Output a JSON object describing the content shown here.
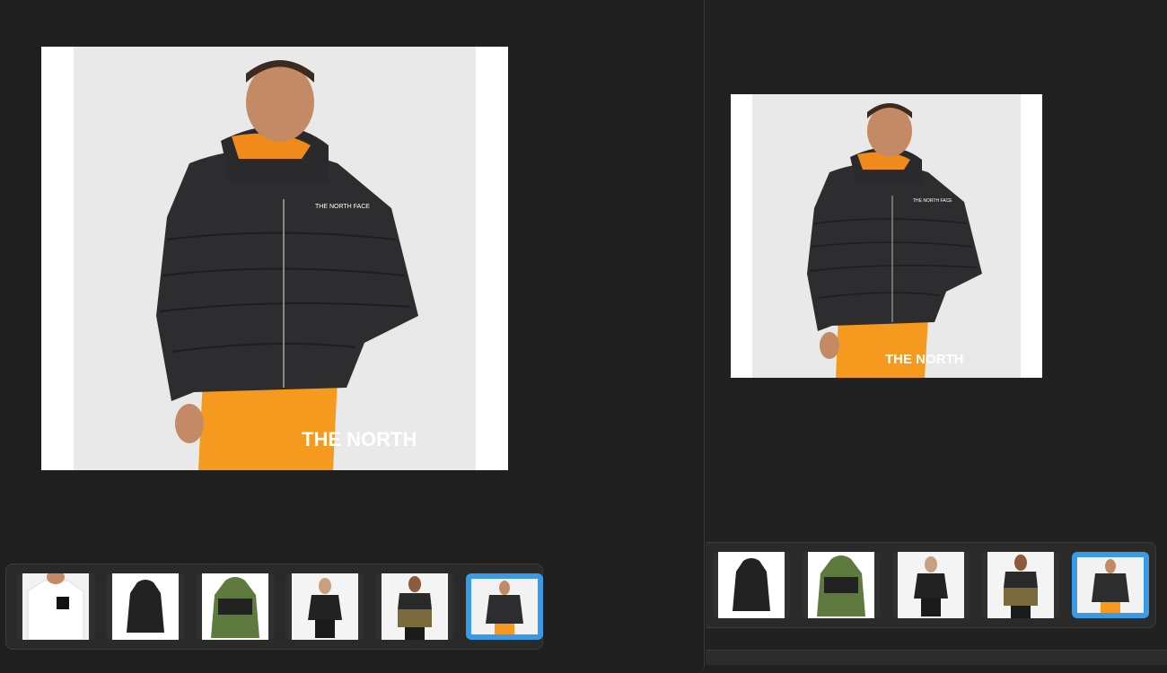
{
  "viewer": {
    "left_panel": {
      "main_image": {
        "description_icon": "product-photo-black-puffer-jacket",
        "logo_text": "THE NORTH FACE",
        "pants_text": "THE NORTH"
      },
      "thumbnails": [
        {
          "icon": "white-tshirt-thumb",
          "selected": false
        },
        {
          "icon": "black-parka-thumb",
          "selected": false
        },
        {
          "icon": "green-black-jacket-thumb",
          "selected": false
        },
        {
          "icon": "woman-black-jacket-thumb",
          "selected": false
        },
        {
          "icon": "olive-black-jacket-thumb",
          "selected": false
        },
        {
          "icon": "black-puffer-orange-hood-thumb",
          "selected": true
        }
      ]
    },
    "right_panel": {
      "main_image": {
        "description_icon": "product-photo-black-puffer-jacket",
        "logo_text": "THE NORTH FACE",
        "pants_text": "THE NORTH"
      },
      "thumbnails": [
        {
          "icon": "black-parka-thumb",
          "selected": false
        },
        {
          "icon": "green-black-jacket-thumb",
          "selected": false
        },
        {
          "icon": "woman-black-jacket-thumb",
          "selected": false
        },
        {
          "icon": "olive-black-jacket-thumb",
          "selected": false
        },
        {
          "icon": "black-puffer-orange-hood-thumb",
          "selected": true
        }
      ]
    }
  },
  "colors": {
    "background": "#1e1e1e",
    "selection": "#3b9ae8",
    "jacket": "#2b2b2d",
    "pants": "#f5921e"
  }
}
